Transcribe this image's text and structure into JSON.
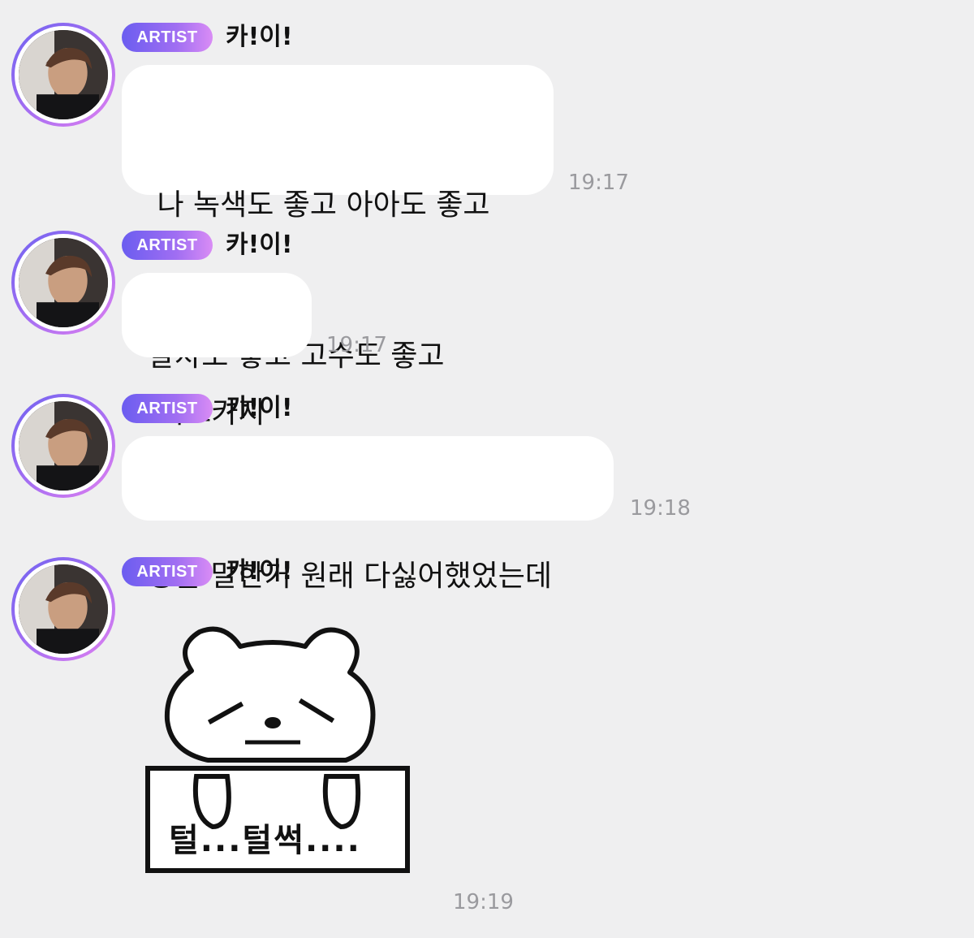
{
  "messages": [
    {
      "badge": "ARTIST",
      "sender": "카!이!",
      "line1": " 나 녹색도 좋고 아아도 좋고",
      "line2": "말차도 좋고 고수도 좋고",
      "time": "19:17"
    },
    {
      "badge": "ARTIST",
      "sender": "카!이!",
      "text": "어뜨카지",
      "time": "19:17"
    },
    {
      "badge": "ARTIST",
      "sender": "카!이!",
      "text": "방금 말한거 원래 다싫어했었는데",
      "time": "19:18"
    },
    {
      "badge": "ARTIST",
      "sender": "카!이!",
      "sticker_text": "털...털썩....",
      "time": "19:19"
    }
  ],
  "colors": {
    "background": "#efeff0",
    "badge_gradient_start": "#6b5df0",
    "badge_gradient_end": "#d98cf5",
    "bubble": "#ffffff",
    "timestamp": "#9a9a9e"
  },
  "icons": [
    "profile-avatar",
    "bear-sticker"
  ]
}
